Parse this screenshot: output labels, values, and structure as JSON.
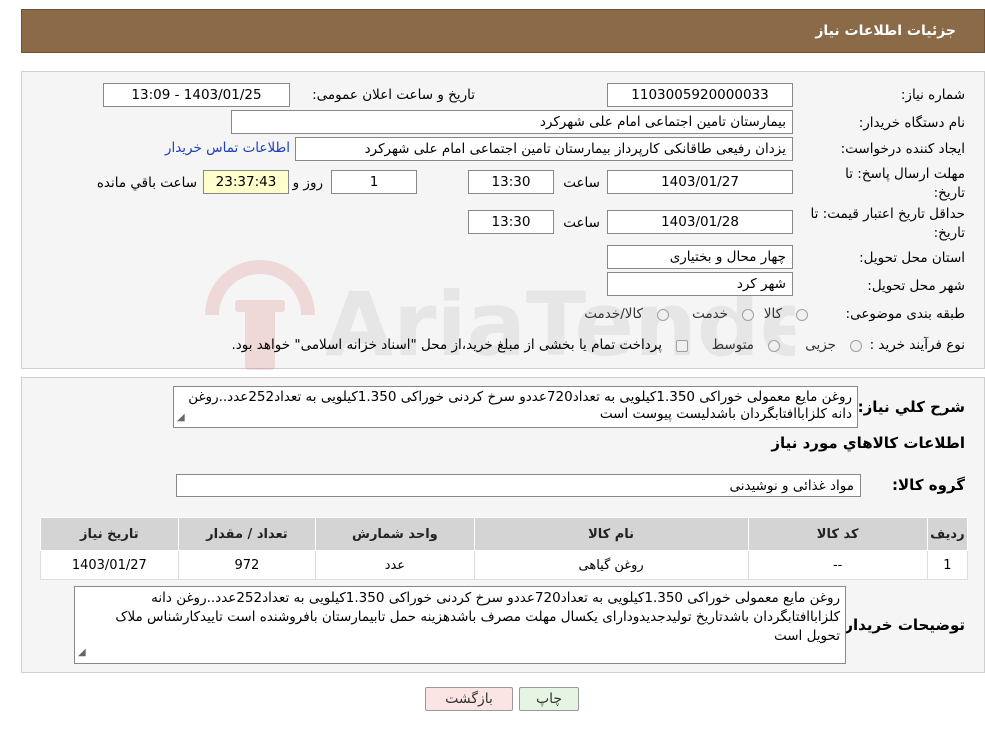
{
  "header": {
    "title": "جزئیات اطلاعات نیاز"
  },
  "form": {
    "need_number_label": "شماره نیاز:",
    "need_number": "1103005920000033",
    "announce_label": "تاریخ و ساعت اعلان عمومی:",
    "announce_value": "1403/01/25 - 13:09",
    "buyer_org_label": "نام دستگاه خریدار:",
    "buyer_org": "بیمارستان تامین اجتماعی امام علی شهرکرد",
    "creator_label": "ایجاد کننده درخواست:",
    "creator": "یزدان رفیعی طاقانکی کارپرداز بیمارستان تامین اجتماعی امام علی شهرکرد",
    "buyer_contact_link": "اطلاعات تماس خریدار",
    "reply_deadline_label": "مهلت ارسال پاسخ: تا تاریخ:",
    "reply_date": "1403/01/27",
    "time_label": "ساعت",
    "reply_time": "13:30",
    "days_value": "1",
    "days_label": "روز و",
    "remaining_time": "23:37:43",
    "remaining_label": "ساعت باقي مانده",
    "price_validity_label": "حداقل تاریخ اعتبار قیمت: تا تاریخ:",
    "validity_date": "1403/01/28",
    "validity_time": "13:30",
    "province_label": "استان محل تحویل:",
    "province": "چهار محال و بختیاری",
    "city_label": "شهر محل تحویل:",
    "city": "شهر کرد",
    "category_label": "طبقه بندی موضوعی:",
    "category_options": [
      "کالا",
      "خدمت",
      "کالا/خدمت"
    ],
    "purchase_type_label": "نوع فرآیند خرید :",
    "purchase_options": [
      "جزیی",
      "متوسط"
    ],
    "purchase_note": "پرداخت تمام یا بخشی از مبلغ خرید،از محل \"اسناد خزانه اسلامی\" خواهد بود."
  },
  "summary": {
    "desc_label": "شرح کلي نياز:",
    "desc_text": "روغن مایع معمولی خوراکی 1.350کیلویی به تعداد720عددو سرخ کردنی خوراکی 1.350کیلویی به تعداد252عدد..روغن دانه کلزاباافتابگردان باشدلیست پیوست است",
    "goods_info_title": "اطلاعات کالاهاي مورد نياز",
    "goods_group_label": "گروه کالا:",
    "goods_group": "مواد غذائی و نوشیدنی",
    "table": {
      "headers": [
        "رديف",
        "کد کالا",
        "نام کالا",
        "واحد شمارش",
        "تعداد / مقدار",
        "تاریخ نیاز"
      ],
      "rows": [
        [
          "1",
          "--",
          "روغن گیاهی",
          "عدد",
          "972",
          "1403/01/27"
        ]
      ]
    },
    "buyer_notes_label": "توضیحات خریدار:",
    "buyer_notes": "روغن مایع معمولی خوراکی 1.350کیلویی به تعداد720عددو سرخ کردنی خوراکی 1.350کیلویی به تعداد252عدد..روغن دانه کلزاباافتابگردان باشدتاریخ تولیدجدیدودارای یکسال مهلت مصرف باشدهزینه حمل تابیمارستان بافروشنده است تاییدکارشناس ملاک تحویل است"
  },
  "buttons": {
    "print": "چاپ",
    "back": "بازگشت"
  },
  "watermark": {
    "text": "AriaTender.neT"
  }
}
